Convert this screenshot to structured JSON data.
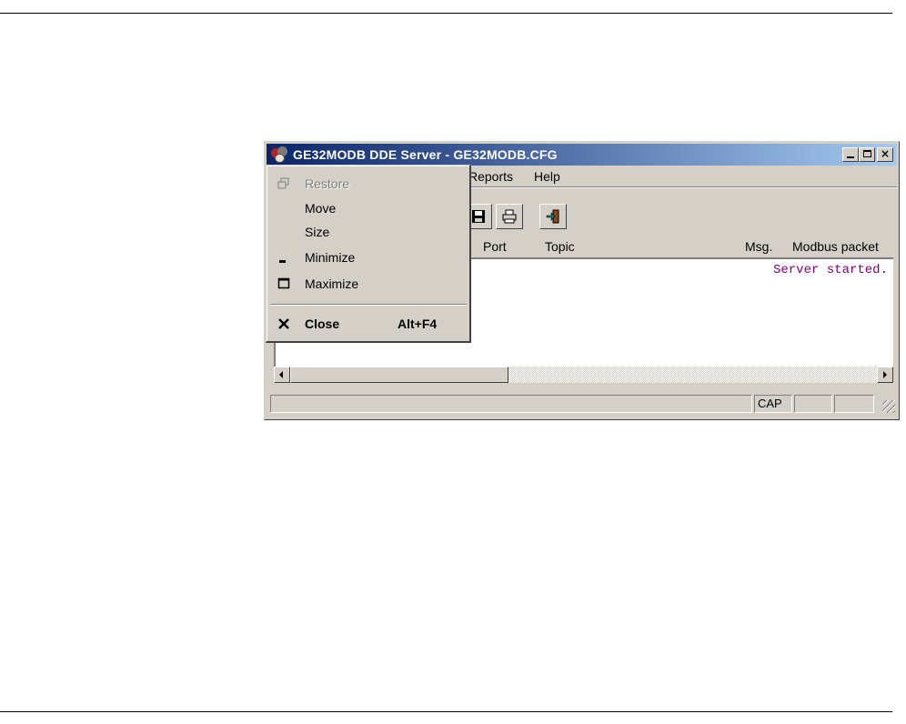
{
  "window": {
    "title": "GE32MODB DDE Server - GE32MODB.CFG"
  },
  "menubar": {
    "items": [
      "Reports",
      "Help"
    ]
  },
  "toolbar": {
    "buttons": [
      "save-icon",
      "print-icon",
      "exit-icon"
    ]
  },
  "columns": [
    "Port",
    "Topic",
    "Msg.",
    "Modbus packet"
  ],
  "log": {
    "lines": [
      "Server started."
    ],
    "color": "#800080"
  },
  "statusbar": {
    "panels": [
      "CAP",
      "",
      ""
    ]
  },
  "system_menu": {
    "items": [
      {
        "label": "Restore",
        "icon": "restore-icon",
        "enabled": false
      },
      {
        "label": "Move",
        "enabled": true
      },
      {
        "label": "Size",
        "enabled": true
      },
      {
        "label": "Minimize",
        "icon": "minimize-icon",
        "enabled": true
      },
      {
        "label": "Maximize",
        "icon": "maximize-icon",
        "enabled": true
      },
      {
        "label": "Close",
        "shortcut": "Alt+F4",
        "icon": "close-icon",
        "enabled": true,
        "bold": true
      }
    ]
  },
  "colors": {
    "titlebar_start": "#0a246a",
    "titlebar_end": "#a6caf0",
    "face": "#d4d0c8"
  }
}
